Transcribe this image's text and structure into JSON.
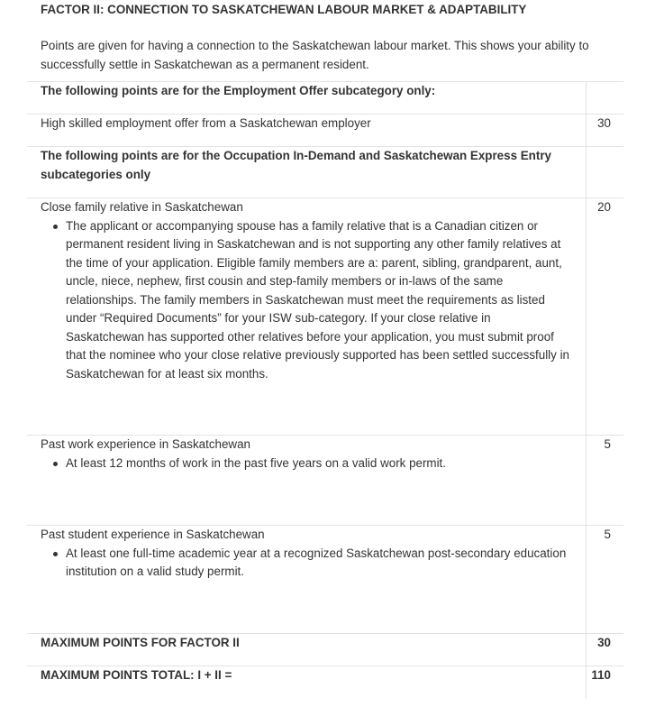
{
  "factor": {
    "title": "FACTOR II: CONNECTION TO SASKATCHEWAN LABOUR MARKET & ADAPTABILITY",
    "intro": "Points are given for having a connection to the Saskatchewan labour market. This shows your ability to successfully settle in Saskatchewan as a permanent resident."
  },
  "table": {
    "employment_header": "The following points are for the Employment Offer subcategory only:",
    "employment_offer": {
      "label": "High skilled employment offer from a Saskatchewan employer",
      "points": "30"
    },
    "indemand_header": "The following points are for the Occupation In-Demand and Saskatchewan Express Entry subcategories only",
    "family": {
      "label": "Close family relative in Saskatchewan",
      "points": "20",
      "bullet": "The applicant or accompanying spouse has a family relative that is a Canadian citizen or permanent resident living in Saskatchewan and is not supporting any other family relatives at the time of your application. Eligible family members are a: parent, sibling, grandparent, aunt, uncle, niece, nephew, first cousin and step-family members or in-laws of the same relationships. The family members in Saskatchewan must meet the requirements as listed under “Required Documents” for your ISW sub-category. If your close relative in Saskatchewan has supported other relatives before your application, you must submit proof that the nominee who your close relative previously supported has been settled successfully in Saskatchewan for at least six months."
    },
    "work": {
      "label": "Past work experience in Saskatchewan",
      "points": "5",
      "bullet": "At least 12 months of work in the past five years on a valid work permit."
    },
    "student": {
      "label": "Past student experience in Saskatchewan",
      "points": "5",
      "bullet": "At least one full-time academic year at a recognized Saskatchewan post-secondary education institution on a valid study permit."
    },
    "max_factor": {
      "label": "MAXIMUM POINTS FOR FACTOR II",
      "points": "30"
    },
    "max_total": {
      "label": "MAXIMUM POINTS TOTAL: I + II =",
      "points": "110"
    }
  }
}
